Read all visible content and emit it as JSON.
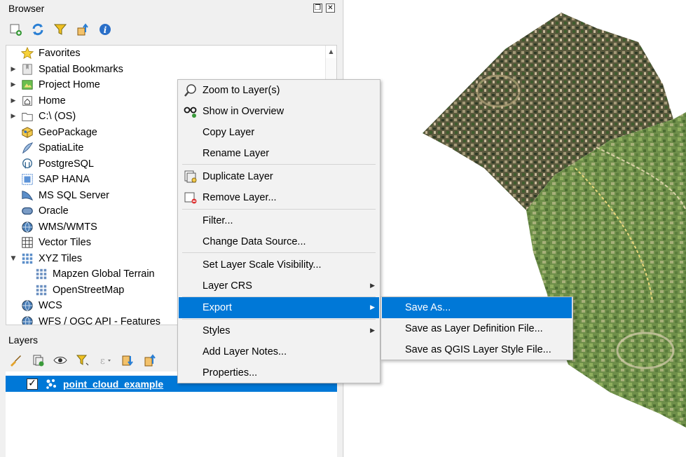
{
  "browser_panel": {
    "title": "Browser",
    "float_glyph": "❐",
    "close_glyph": "✕",
    "toolbar": {
      "icons": [
        "add-layer-icon",
        "refresh-icon",
        "filter-icon",
        "collapse-all-icon",
        "info-icon"
      ]
    },
    "tree": {
      "items": [
        {
          "label": "Favorites",
          "icon": "star-icon",
          "expander": ""
        },
        {
          "label": "Spatial Bookmarks",
          "icon": "bookmark-icon",
          "expander": "▶"
        },
        {
          "label": "Project Home",
          "icon": "project-home-icon",
          "expander": "▶"
        },
        {
          "label": "Home",
          "icon": "home-icon",
          "expander": "▶"
        },
        {
          "label": "C:\\ (OS)",
          "icon": "folder-icon",
          "expander": "▶"
        },
        {
          "label": "GeoPackage",
          "icon": "geopackage-icon",
          "expander": ""
        },
        {
          "label": "SpatiaLite",
          "icon": "spatialite-icon",
          "expander": ""
        },
        {
          "label": "PostgreSQL",
          "icon": "postgresql-icon",
          "expander": ""
        },
        {
          "label": "SAP HANA",
          "icon": "sap-hana-icon",
          "expander": ""
        },
        {
          "label": "MS SQL Server",
          "icon": "mssql-icon",
          "expander": ""
        },
        {
          "label": "Oracle",
          "icon": "oracle-icon",
          "expander": ""
        },
        {
          "label": "WMS/WMTS",
          "icon": "wms-globe-icon",
          "expander": ""
        },
        {
          "label": "Vector Tiles",
          "icon": "vector-tiles-icon",
          "expander": ""
        },
        {
          "label": "XYZ Tiles",
          "icon": "xyz-tiles-icon",
          "expander": "▼"
        },
        {
          "label": "Mapzen Global Terrain",
          "icon": "tile-grid-icon",
          "expander": ""
        },
        {
          "label": "OpenStreetMap",
          "icon": "tile-grid-icon",
          "expander": ""
        },
        {
          "label": "WCS",
          "icon": "wcs-globe-icon",
          "expander": ""
        },
        {
          "label": "WFS / OGC API - Features",
          "icon": "wfs-globe-icon",
          "expander": ""
        }
      ]
    }
  },
  "layers_panel": {
    "title": "Layers",
    "toolbar": {
      "icons": [
        "style-brush-icon",
        "add-group-icon",
        "eye-visibility-icon",
        "filter-legend-icon",
        "expression-filter-icon",
        "expand-all-icon",
        "collapse-all-icon"
      ]
    },
    "layers": [
      {
        "name": "point_cloud_example",
        "checked": true,
        "check_glyph": "✓",
        "icon": "point-cloud-icon"
      }
    ]
  },
  "context_menu": {
    "items": [
      {
        "label": "Zoom to Layer(s)",
        "icon": "zoom-magnifier-icon"
      },
      {
        "label": "Show in Overview",
        "icon": "overview-glasses-icon"
      },
      {
        "label": "Copy Layer",
        "icon": ""
      },
      {
        "label": "Rename Layer",
        "icon": ""
      },
      {
        "label": "Duplicate Layer",
        "icon": "duplicate-layer-icon"
      },
      {
        "label": "Remove Layer...",
        "icon": "remove-layer-icon"
      },
      {
        "label": "Filter...",
        "icon": ""
      },
      {
        "label": "Change Data Source...",
        "icon": ""
      },
      {
        "label": "Set Layer Scale Visibility...",
        "icon": ""
      },
      {
        "label": "Layer CRS",
        "icon": "",
        "submenu": true
      },
      {
        "label": "Export",
        "icon": "",
        "submenu": true,
        "selected": true
      },
      {
        "label": "Styles",
        "icon": "",
        "submenu": true
      },
      {
        "label": "Add Layer Notes...",
        "icon": ""
      },
      {
        "label": "Properties...",
        "icon": ""
      }
    ],
    "submenu_arrow": "▶"
  },
  "export_submenu": {
    "items": [
      {
        "label": "Save As...",
        "selected": true
      },
      {
        "label": "Save as Layer Definition File..."
      },
      {
        "label": "Save as QGIS Layer Style File..."
      }
    ]
  },
  "colors": {
    "selection": "#0078d7",
    "panel_bg": "#f0f0f0",
    "menu_bg": "#f2f2f2"
  }
}
